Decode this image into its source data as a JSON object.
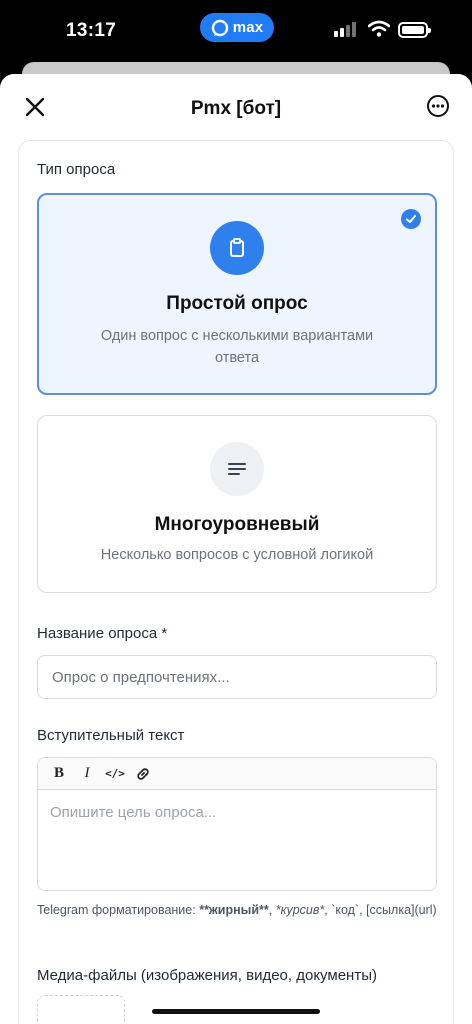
{
  "status_bar": {
    "time": "13:17",
    "app_pill": "max",
    "accent": "#1f7cf5"
  },
  "header": {
    "title": "Pmx [бот]",
    "close_icon": "close-icon",
    "more_icon": "more-icon"
  },
  "poll_type": {
    "label": "Тип опроса",
    "options": [
      {
        "title": "Простой опрос",
        "description": "Один вопрос с несколькими вариантами ответа",
        "icon": "clipboard-icon",
        "selected": true
      },
      {
        "title": "Многоуровневый",
        "description": "Несколько вопросов с условной логикой",
        "icon": "lines-icon",
        "selected": false
      }
    ]
  },
  "poll_name": {
    "label": "Название опроса *",
    "placeholder": "Опрос о предпочтениях..."
  },
  "intro": {
    "label": "Вступительный текст",
    "toolbar": [
      "B",
      "I",
      "</>",
      "link"
    ],
    "placeholder": "Опишите цель опроса...",
    "hint_prefix": "Telegram форматирование: ",
    "hint_bold": "**жирный**",
    "hint_sep1": ", ",
    "hint_italic": "*курсив*",
    "hint_sep2": ", `код`, [ссылка](url)"
  },
  "media": {
    "label": "Медиа-файлы (изображения, видео, документы)"
  }
}
